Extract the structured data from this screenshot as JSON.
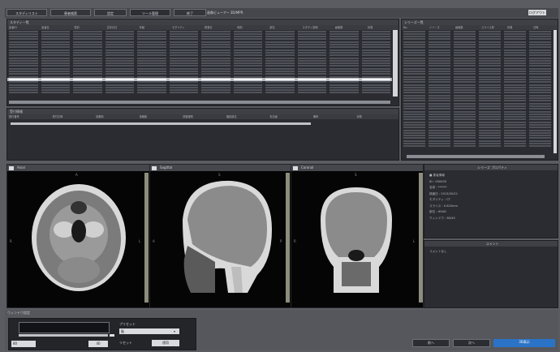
{
  "tabs": [
    "スタディリスト",
    "患者検索",
    "設定",
    "ツール管理",
    "終了"
  ],
  "window_title": "画像ビューアー 3D/MPR",
  "window_button": "ログアウト",
  "study_panel": {
    "title": "スタディ一覧",
    "columns": [
      "患者ID",
      "患者名",
      "性別",
      "生年月日",
      "年齢",
      "モダリティ",
      "検査日",
      "時刻",
      "部位",
      "スタディ説明",
      "画像数",
      "状態"
    ]
  },
  "series_panel": {
    "title": "シリーズ一覧",
    "columns": [
      "No.",
      "シリーズ",
      "画像数",
      "スライス厚",
      "状態",
      "日時"
    ]
  },
  "info_panel": {
    "title": "受付情報",
    "columns": [
      "受付番号",
      "受付日時",
      "依頼科",
      "依頼医",
      "検査種別",
      "撮影部位",
      "担当者",
      "備考",
      "状態"
    ]
  },
  "viewports": {
    "axial": {
      "title": "Axial",
      "top": "A",
      "left": "R",
      "right": "L"
    },
    "sagittal": {
      "title": "Sagittal",
      "top": "S",
      "left": "A",
      "right": "P"
    },
    "coronal": {
      "title": "Coronal",
      "top": "S",
      "left": "R",
      "right": "L"
    }
  },
  "properties_panel": {
    "title": "シリーズ プロパティ",
    "lines": [
      "■ 患者情報",
      "ID : 000000",
      "名前 : ******",
      "検査日 : 2013/05/21",
      "モダリティ : CT",
      "スライス : 0.625mm",
      "部位 : HEAD",
      "ウィンドウ : 80/40"
    ]
  },
  "comment_panel": {
    "title": "コメント",
    "lines": [
      "コメントなし"
    ]
  },
  "bottom_panel": {
    "title": "ウィンドウ設定",
    "preset_label": "プリセット",
    "preset_value": "脳",
    "reset_label": "リセット",
    "apply_label": "適用",
    "value_left": "80",
    "value_right": "40"
  },
  "bottom_buttons": {
    "prev": "前へ",
    "next": "次へ",
    "primary": "3D表示"
  }
}
